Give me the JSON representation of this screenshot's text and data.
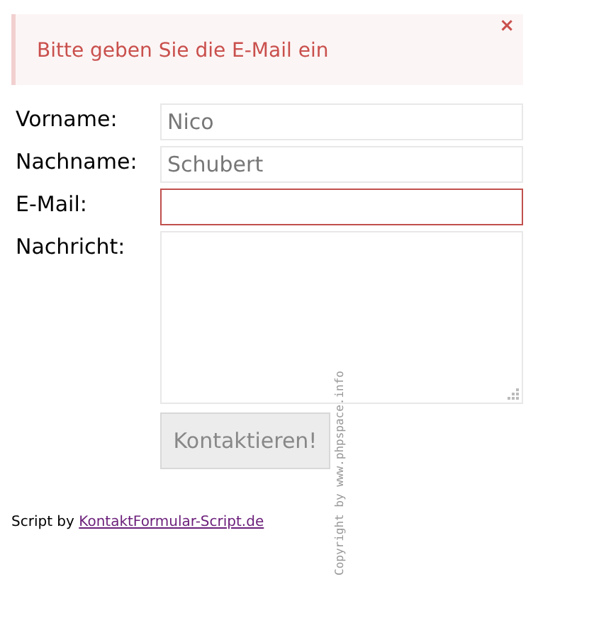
{
  "alert": {
    "message": "Bitte geben Sie die E-Mail ein",
    "close": "×"
  },
  "fields": [
    {
      "label": "Vorname:",
      "kind": "input",
      "value": "Nico",
      "invalid": false
    },
    {
      "label": "Nachname:",
      "kind": "input",
      "value": "Schubert",
      "invalid": false
    },
    {
      "label": "E-Mail:",
      "kind": "input",
      "invalid": true
    },
    {
      "label": "Nachricht:",
      "kind": "textarea",
      "invalid": false
    }
  ],
  "submit_button": "Kontaktieren!",
  "footer": {
    "prefix": "Script by",
    "link": "KontaktFormular-Script.de"
  },
  "copyright": "Copyright by www.phpspace.info"
}
